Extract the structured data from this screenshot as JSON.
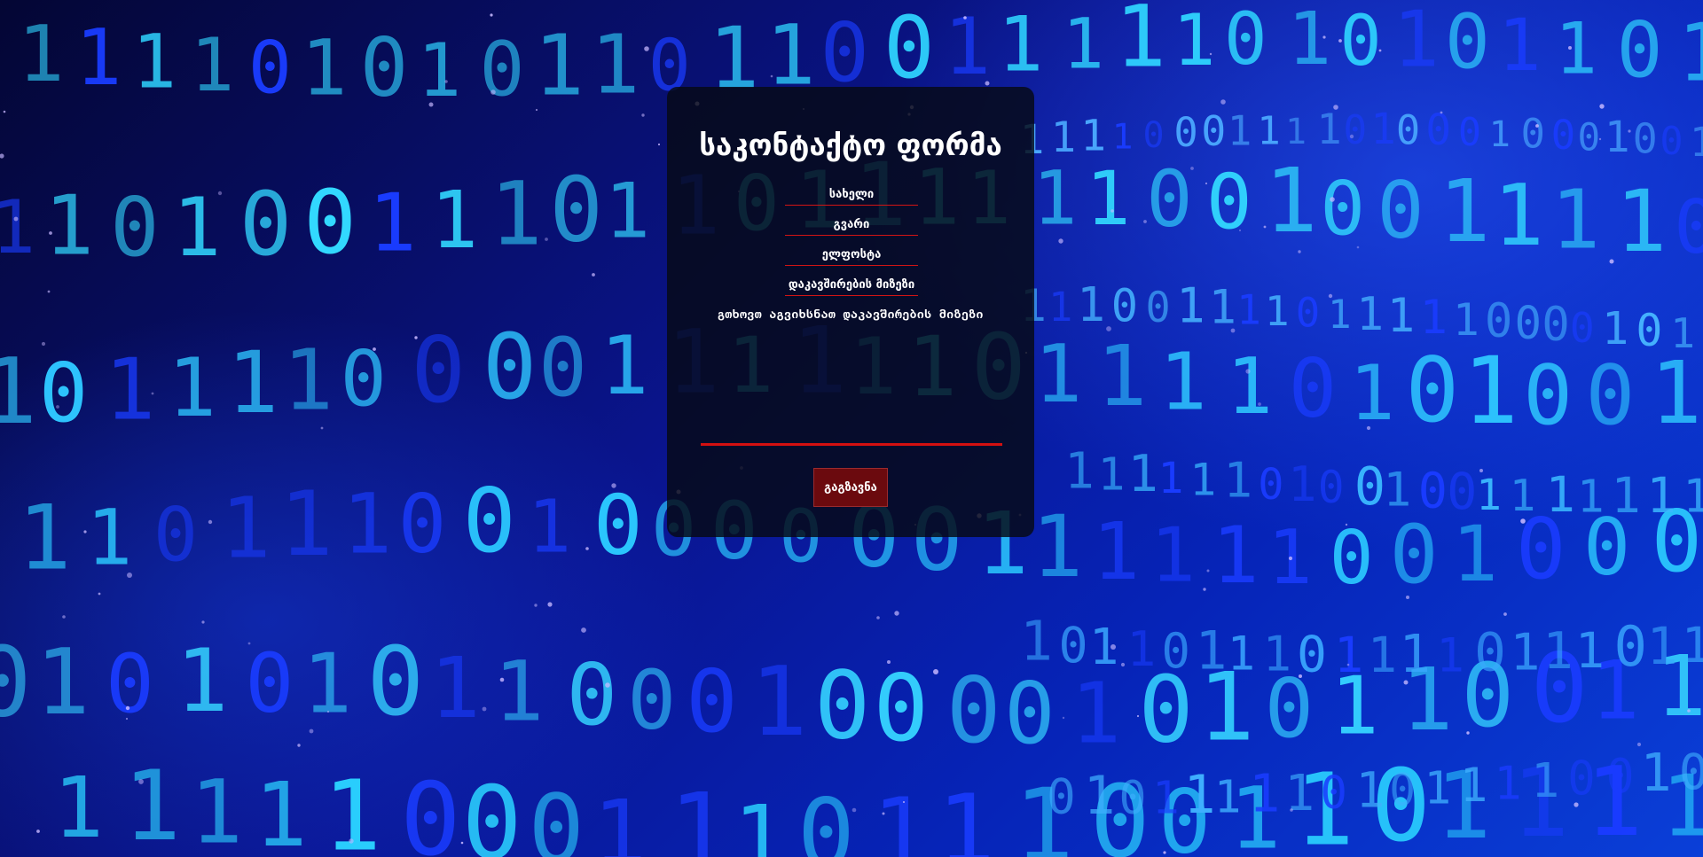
{
  "form": {
    "title": "საკონტაქტო ფორმა",
    "fields": {
      "first_name_placeholder": "სახელი",
      "last_name_placeholder": "გვარი",
      "email_placeholder": "ელფოსტა",
      "subject_placeholder": "დაკავშირების მიზეზი"
    },
    "message_label": "გთხოვთ აგვიხსნათ დაკავშირების მიზეზი",
    "submit_label": "გაგზავნა"
  },
  "colors": {
    "accent_red": "#d21414",
    "button_bg": "#6b0a0e",
    "panel_bg": "#060a14"
  }
}
